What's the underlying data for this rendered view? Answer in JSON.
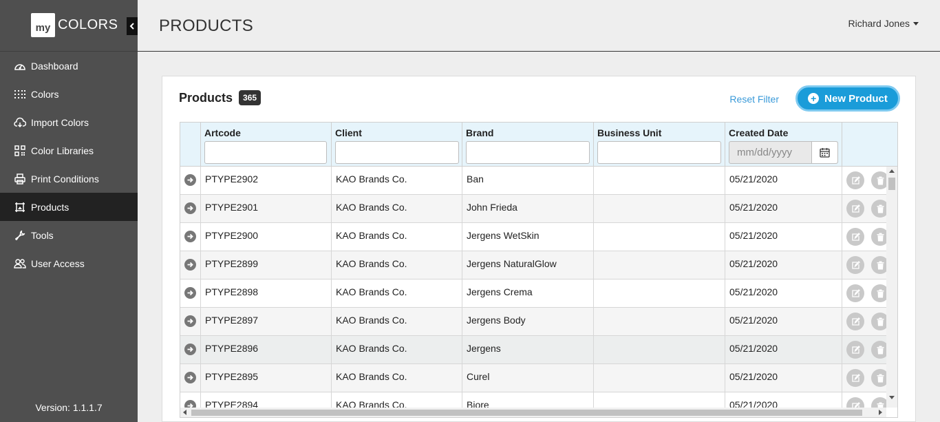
{
  "app": {
    "logo_my": "my",
    "logo_colors": "COLORS",
    "version": "Version: 1.1.1.7"
  },
  "sidebar": {
    "items": [
      {
        "label": "Dashboard",
        "icon": "dashboard-icon",
        "active": false
      },
      {
        "label": "Colors",
        "icon": "colors-grid-icon",
        "active": false
      },
      {
        "label": "Import Colors",
        "icon": "cloud-download-icon",
        "active": false
      },
      {
        "label": "Color Libraries",
        "icon": "qr-library-icon",
        "active": false
      },
      {
        "label": "Print Conditions",
        "icon": "printer-icon",
        "active": false
      },
      {
        "label": "Products",
        "icon": "product-frame-icon",
        "active": true
      },
      {
        "label": "Tools",
        "icon": "wrench-icon",
        "active": false
      },
      {
        "label": "User Access",
        "icon": "users-icon",
        "active": false
      }
    ]
  },
  "header": {
    "title": "PRODUCTS",
    "user_name": "Richard Jones"
  },
  "panel": {
    "title": "Products",
    "count": "365",
    "reset_filter": "Reset Filter",
    "new_product": "New Product"
  },
  "table": {
    "columns": [
      "Artcode",
      "Client",
      "Brand",
      "Business Unit",
      "Created Date"
    ],
    "date_placeholder": "mm/dd/yyyy",
    "rows": [
      {
        "artcode": "PTYPE2902",
        "client": "KAO Brands Co.",
        "brand": "Ban",
        "business_unit": "",
        "created": "05/21/2020"
      },
      {
        "artcode": "PTYPE2901",
        "client": "KAO Brands Co.",
        "brand": "John Frieda",
        "business_unit": "",
        "created": "05/21/2020"
      },
      {
        "artcode": "PTYPE2900",
        "client": "KAO Brands Co.",
        "brand": "Jergens WetSkin",
        "business_unit": "",
        "created": "05/21/2020"
      },
      {
        "artcode": "PTYPE2899",
        "client": "KAO Brands Co.",
        "brand": "Jergens NaturalGlow",
        "business_unit": "",
        "created": "05/21/2020"
      },
      {
        "artcode": "PTYPE2898",
        "client": "KAO Brands Co.",
        "brand": "Jergens Crema",
        "business_unit": "",
        "created": "05/21/2020"
      },
      {
        "artcode": "PTYPE2897",
        "client": "KAO Brands Co.",
        "brand": "Jergens Body",
        "business_unit": "",
        "created": "05/21/2020"
      },
      {
        "artcode": "PTYPE2896",
        "client": "KAO Brands Co.",
        "brand": "Jergens",
        "business_unit": "",
        "created": "05/21/2020"
      },
      {
        "artcode": "PTYPE2895",
        "client": "KAO Brands Co.",
        "brand": "Curel",
        "business_unit": "",
        "created": "05/21/2020"
      },
      {
        "artcode": "PTYPE2894",
        "client": "KAO Brands Co.",
        "brand": "Biore",
        "business_unit": "",
        "created": "05/21/2020"
      }
    ]
  },
  "colors": {
    "sidebar_bg": "#4f4f4f",
    "sidebar_active": "#222222",
    "accent": "#1a9cd9",
    "link": "#3a9ad9",
    "table_header_bg": "#e6f4fb"
  }
}
